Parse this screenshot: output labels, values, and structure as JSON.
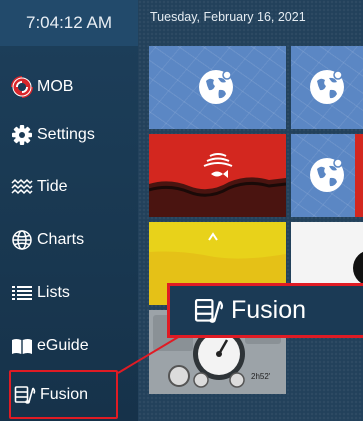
{
  "status": {
    "time": "7:04:12 AM",
    "date": "Tuesday, February 16, 2021"
  },
  "sidebar": {
    "items": [
      {
        "label": "MOB",
        "icon": "lifebuoy-icon"
      },
      {
        "label": "Settings",
        "icon": "gear-icon"
      },
      {
        "label": "Tide",
        "icon": "waves-icon"
      },
      {
        "label": "Charts",
        "icon": "globe-icon"
      },
      {
        "label": "Lists",
        "icon": "list-icon"
      },
      {
        "label": "eGuide",
        "icon": "book-icon"
      },
      {
        "label": "Fusion",
        "icon": "fusion-audio-icon"
      }
    ]
  },
  "tiles": [
    {
      "type": "chart",
      "icon": "globe-icon"
    },
    {
      "type": "chart",
      "icon": "globe-icon"
    },
    {
      "type": "sonar",
      "icon": "fish-finder-icon"
    },
    {
      "type": "chart",
      "icon": "globe-icon"
    },
    {
      "type": "sonar-yellow"
    },
    {
      "type": "compass"
    },
    {
      "type": "gauges"
    }
  ],
  "callout": {
    "label": "Fusion",
    "icon": "fusion-audio-icon"
  },
  "gauge_readout": "2h52'",
  "colors": {
    "highlight": "#e01b24",
    "chart_tile": "#5b87c4",
    "sonar_tile": "#d3271f",
    "sidebar": "#1b3a55"
  }
}
